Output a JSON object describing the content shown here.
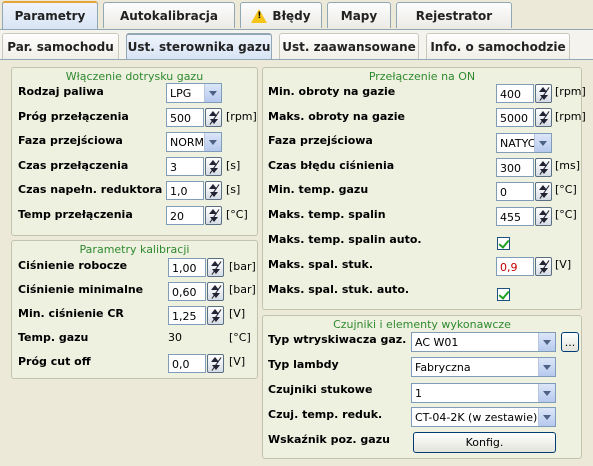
{
  "tabs_main": [
    "Parametry",
    "Autokalibracja",
    "Błędy",
    "Mapy",
    "Rejestrator"
  ],
  "tabs_sub": [
    "Par. samochodu",
    "Ust. sterownika gazu",
    "Ust. zaawansowane",
    "Info. o samochodzie"
  ],
  "switch": {
    "title": "Włączenie dotrysku gazu",
    "fuel_label": "Rodzaj paliwa",
    "fuel_value": "LPG",
    "threshold_label": "Próg przełączenia",
    "threshold_value": "500",
    "threshold_unit": "[rpm]",
    "phase_label": "Faza przejściowa",
    "phase_value": "NORMAL",
    "time_label": "Czas przełączenia",
    "time_value": "3",
    "time_unit": "[s]",
    "fill_label": "Czas napełn. reduktora",
    "fill_value": "1,0",
    "fill_unit": "[s]",
    "temp_label": "Temp przełączenia",
    "temp_value": "20",
    "temp_unit": "[°C]"
  },
  "calib": {
    "title": "Parametry kalibracji",
    "work_label": "Ciśnienie robocze",
    "work_value": "1,00",
    "work_unit": "[bar]",
    "min_label": "Ciśnienie minimalne",
    "min_value": "0,60",
    "min_unit": "[bar]",
    "cr_label": "Min. ciśnienie CR",
    "cr_value": "1,25",
    "cr_unit": "[V]",
    "gas_temp_label": "Temp. gazu",
    "gas_temp_value": "30",
    "gas_temp_unit": "[°C]",
    "cutoff_label": "Próg cut off",
    "cutoff_value": "0,0",
    "cutoff_unit": "[V]"
  },
  "on": {
    "title": "Przełączenie na ON",
    "minrpm_label": "Min. obroty na gazie",
    "minrpm_value": "400",
    "minrpm_unit": "[rpm]",
    "maxrpm_label": "Maks. obroty na gazie",
    "maxrpm_value": "5000",
    "maxrpm_unit": "[rpm]",
    "phase_label": "Faza przejściowa",
    "phase_value": "NATYCH",
    "errtime_label": "Czas błędu ciśnienia",
    "errtime_value": "300",
    "errtime_unit": "[ms]",
    "mingas_label": "Min. temp. gazu",
    "mingas_value": "0",
    "mingas_unit": "[°C]",
    "maxexh_label": "Maks. temp. spalin",
    "maxexh_value": "455",
    "maxexh_unit": "[°C]",
    "maxexh_auto_label": "Maks. temp. spalin auto.",
    "knock_label": "Maks. spal. stuk.",
    "knock_value": "0,9",
    "knock_unit": "[V]",
    "knock_auto_label": "Maks. spal. stuk. auto."
  },
  "sensors": {
    "title": "Czujniki i elementy wykonawcze",
    "injector_label": "Typ wtryskiwacza gaz.",
    "injector_value": "AC W01",
    "injector_btn": "...",
    "lambda_label": "Typ lambdy",
    "lambda_value": "Fabryczna",
    "knock_label": "Czujniki stukowe",
    "knock_value": "1",
    "reducer_label": "Czuj. temp. reduk.",
    "reducer_value": "CT-04-2K (w zestawie)",
    "level_label": "Wskaźnik poz. gazu",
    "level_btn": "Konfig."
  }
}
